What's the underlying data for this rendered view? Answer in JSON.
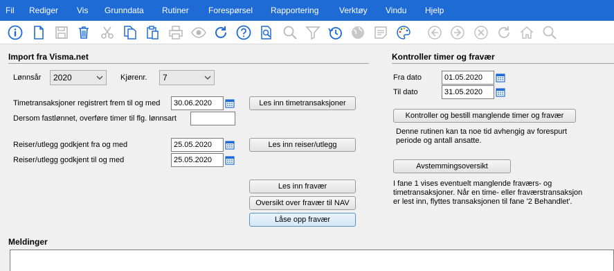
{
  "menu": {
    "items": [
      "Fil",
      "Rediger",
      "Vis",
      "Grunndata",
      "Rutiner",
      "Forespørsel",
      "Rapportering",
      "Verktøy",
      "Vindu",
      "Hjelp"
    ]
  },
  "toolbar": {
    "icons": [
      "info-icon",
      "new-document-icon",
      "save-icon",
      "delete-icon",
      "cut-icon",
      "copy-icon",
      "paste-icon",
      "print-icon",
      "preview-icon",
      "refresh-icon",
      "help-icon",
      "search-help-icon",
      "search-icon",
      "filter-icon",
      "history-icon",
      "globe-icon",
      "notes-icon",
      "palette-icon",
      "back-icon",
      "forward-icon",
      "cancel-icon",
      "reload-icon",
      "home-icon",
      "find-icon"
    ]
  },
  "import": {
    "title": "Import fra Visma.net",
    "year_label": "Lønnsår",
    "year_value": "2020",
    "run_label": "Kjørenr.",
    "run_value": "7",
    "time_label": "Timetransaksjoner registrert frem til og med",
    "time_date": "30.06.2020",
    "time_button": "Les inn timetransaksjoner",
    "fixed_label": "Dersom fastlønnet, overføre timer til flg. lønnsart",
    "fixed_value": "",
    "travel_from_label": "Reiser/utlegg godkjent fra og med",
    "travel_from_date": "25.05.2020",
    "travel_to_label": "Reiser/utlegg godkjent til og med",
    "travel_to_date": "25.05.2020",
    "travel_button": "Les inn reiser/utlegg",
    "absence_button": "Les inn fravær",
    "nav_button": "Oversikt over fravær til NAV",
    "unlock_button": "Låse opp fravær"
  },
  "control": {
    "title": "Kontroller timer og fravær",
    "from_label": "Fra dato",
    "from_date": "01.05.2020",
    "to_label": "Til dato",
    "to_date": "31.05.2020",
    "check_button": "Kontroller og bestill manglende timer og fravær",
    "note1_line1": "Denne rutinen kan ta noe tid avhengig av forespurt",
    "note1_line2": "periode og antall ansatte.",
    "recon_button": "Avstemmingsoversikt",
    "note2_line1": "I fane 1 vises eventuelt manglende fraværs- og",
    "note2_line2": "timetransaksjoner. Når en time- eller fraværstransaksjon",
    "note2_line3": "er lest inn, flyttes transaksjonen til fane '2 Behandlet'."
  },
  "messages": {
    "title": "Meldinger"
  }
}
